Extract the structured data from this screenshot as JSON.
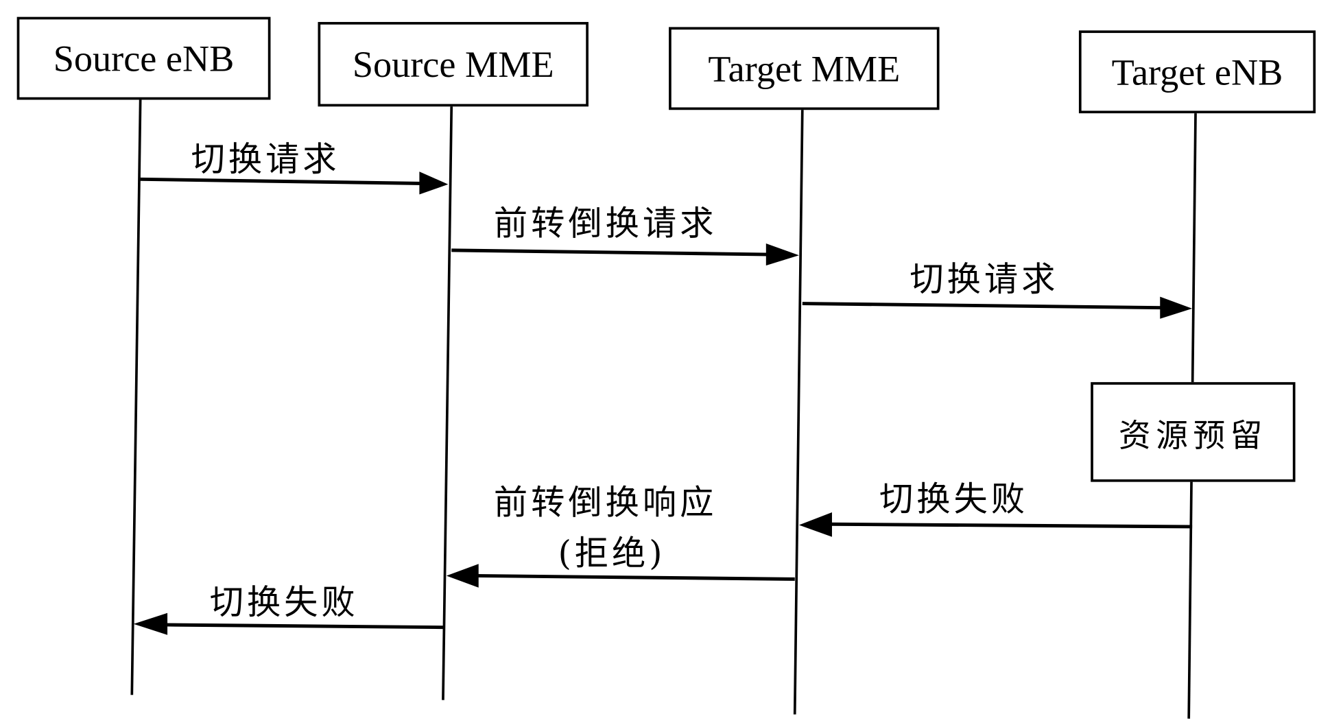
{
  "diagram": {
    "type": "sequence-diagram",
    "participants": [
      {
        "id": "source-enb",
        "label": "Source eNB"
      },
      {
        "id": "source-mme",
        "label": "Source MME"
      },
      {
        "id": "target-mme",
        "label": "Target MME"
      },
      {
        "id": "target-enb",
        "label": "Target eNB"
      }
    ],
    "messages": [
      {
        "from": "source-enb",
        "to": "source-mme",
        "label": "切换请求"
      },
      {
        "from": "source-mme",
        "to": "target-mme",
        "label": "前转倒换请求"
      },
      {
        "from": "target-mme",
        "to": "target-enb",
        "label": "切换请求"
      },
      {
        "from": "target-enb",
        "to": "target-mme",
        "label": "切换失败"
      },
      {
        "from": "target-mme",
        "to": "source-mme",
        "label": "前转倒换响应",
        "label_line2": "(拒绝)"
      },
      {
        "from": "source-mme",
        "to": "source-enb",
        "label": "切换失败"
      }
    ],
    "notes": [
      {
        "participant": "target-enb",
        "label": "资源预留"
      }
    ]
  }
}
